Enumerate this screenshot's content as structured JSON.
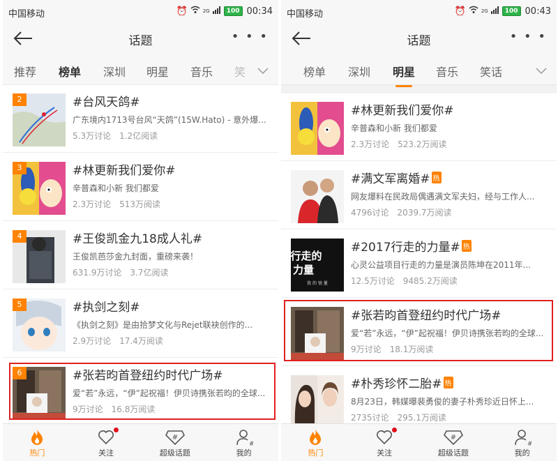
{
  "status": {
    "carrier": "中国移动",
    "net": "2G",
    "battery": "100"
  },
  "screens": [
    {
      "time": "00:34",
      "title": "话题",
      "tabs": [
        "推荐",
        "榜单",
        "深圳",
        "明星",
        "音乐",
        "笑"
      ],
      "active_tab": "榜单",
      "items": [
        {
          "rank": "2",
          "name": "#台风天鸽#",
          "desc": "广东境内1713号台风“天鸽”(15W.Hato) - 意外爆...",
          "discuss": "5.3万讨论",
          "read": "1.2亿阅读"
        },
        {
          "rank": "3",
          "name": "#林更新我们爱你#",
          "desc": "辛普森和小新 我们都爱",
          "discuss": "2.3万讨论",
          "read": "513万阅读"
        },
        {
          "rank": "4",
          "name": "#王俊凯金九18成人礼#",
          "desc": "王俊凯芭莎金九封面，重磅来袭！",
          "discuss": "631.9万讨论",
          "read": "3.7亿阅读"
        },
        {
          "rank": "5",
          "name": "#执剑之刻#",
          "desc": "《执剑之刻》是由拾梦文化与Rejet联袂创作的...",
          "discuss": "2.9万讨论",
          "read": "17.4万阅读"
        },
        {
          "rank": "6",
          "name": "#张若昀首登纽约时代广场#",
          "desc": "爱“若”永远，“伊”起祝福！伊贝诗携张若昀的全球...",
          "discuss": "9万讨论",
          "read": "16.8万阅读"
        }
      ]
    },
    {
      "time": "00:43",
      "title": "话题",
      "tabs": [
        "榜单",
        "深圳",
        "明星",
        "音乐",
        "笑话"
      ],
      "active_tab": "明星",
      "items": [
        {
          "name": "#林更新我们爱你#",
          "desc": "辛普森和小新 我们都爱",
          "discuss": "2.3万讨论",
          "read": "523.2万阅读",
          "hot": ""
        },
        {
          "name": "#满文军离婚#",
          "desc": "网友爆料在民政局偶遇满文军夫妇，经与工作人...",
          "discuss": "4796讨论",
          "read": "2039.7万阅读",
          "hot": "热"
        },
        {
          "name": "#2017行走的力量#",
          "desc": "心灵公益项目行走的力量是演员陈坤在2011年...",
          "discuss": "12.5万讨论",
          "read": "9485.2万阅读",
          "hot": "热"
        },
        {
          "name": "#张若昀首登纽约时代广场#",
          "desc": "爱“若”永远，“伊”起祝福！伊贝诗携张若昀的全球...",
          "discuss": "9万讨论",
          "read": "18.1万阅读",
          "hot": ""
        },
        {
          "name": "#朴秀珍怀二胎#",
          "desc": "8月23日，韩媒曝裴勇俊的妻子朴秀珍近日怀上...",
          "discuss": "2735讨论",
          "read": "295.1万阅读",
          "hot": "热"
        }
      ]
    }
  ],
  "thumb_texts": {
    "walk_line1": "行走的",
    "walk_line2": "力量",
    "walk_line3": "我 的 锐 量"
  },
  "bottom_nav": [
    "热门",
    "关注",
    "超级话题",
    "我的"
  ],
  "colors": {
    "accent": "#ff8200",
    "highlight": "#e02020",
    "badge_dot": "#e0101a"
  }
}
